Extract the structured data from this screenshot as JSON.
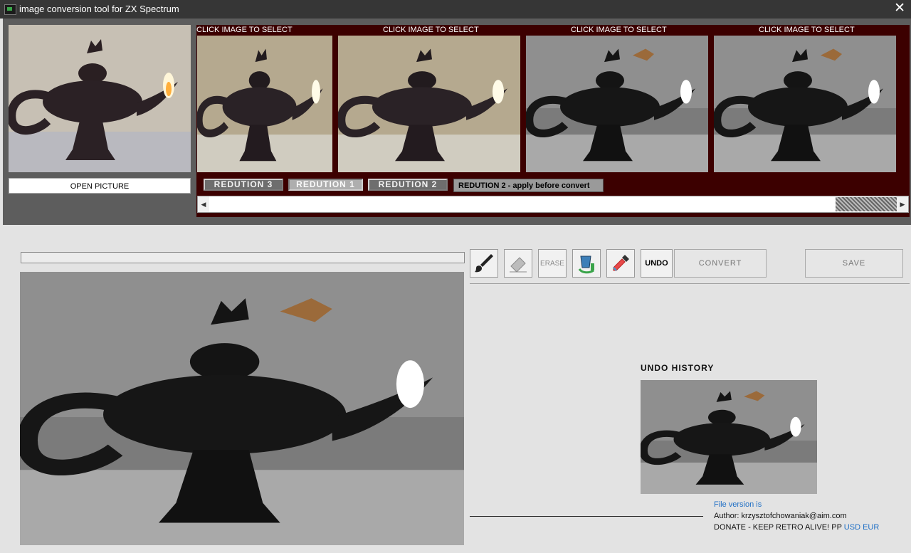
{
  "window": {
    "title": "image conversion tool for ZX Spectrum",
    "close_glyph": "✕"
  },
  "sidebar": {
    "open_picture_label": "OPEN PICTURE"
  },
  "conversions": {
    "captions": [
      "CLICK IMAGE TO SELECT",
      "CLICK IMAGE TO SELECT",
      "CLICK IMAGE TO SELECT",
      "CLICK IMAGE TO SELECT"
    ],
    "buttons": [
      "REDUTION 3",
      "REDUTION 1",
      "REDUTION 2"
    ],
    "active_label": "REDUTION 2 - apply before convert"
  },
  "scroll": {
    "left_glyph": "◀",
    "right_glyph": "▶"
  },
  "toolbar": {
    "icons": [
      "brush-icon",
      "eraser-icon",
      "paint-bucket-icon",
      "eyedropper-icon"
    ],
    "erase_label": "ERASE",
    "undo_label": "UNDO",
    "convert_label": "CONVERT",
    "save_label": "SAVE"
  },
  "undo": {
    "title": "UNDO HISTORY"
  },
  "info": {
    "file_version": "File version is",
    "author": "Author: krzysztofchowaniak@aim.com",
    "donate": "DONATE - KEEP RETRO ALIVE! PP",
    "usd": "USD",
    "eur": "EUR"
  },
  "colors": {
    "accent_panel": "#3c0000",
    "link": "#1f6fc5"
  }
}
